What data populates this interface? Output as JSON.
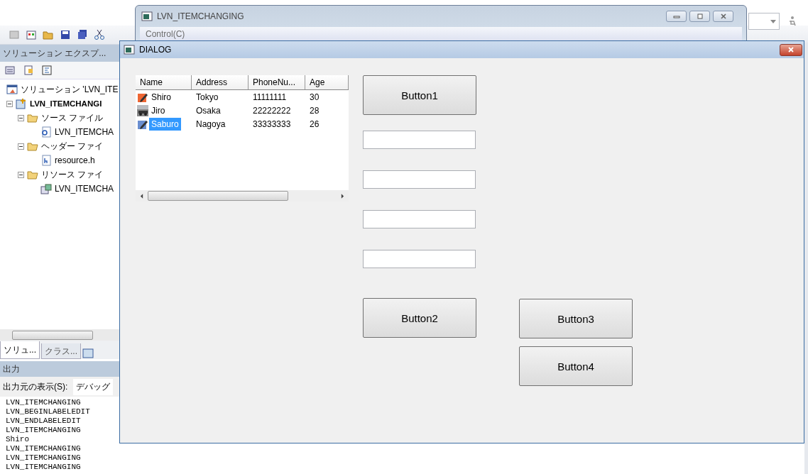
{
  "solution_explorer": {
    "title": "ソリューション エクスプ...",
    "tree": [
      {
        "label": "ソリューション 'LVN_ITE",
        "kind": "solution"
      },
      {
        "label": "LVN_ITEMCHANGI",
        "kind": "project",
        "expanded": true,
        "children": [
          {
            "label": "ソース ファイル",
            "kind": "folder",
            "expanded": true,
            "children": [
              {
                "label": "LVN_ITEMCHA",
                "kind": "cpp"
              }
            ]
          },
          {
            "label": "ヘッダー ファイ",
            "kind": "folder",
            "expanded": true,
            "children": [
              {
                "label": "resource.h",
                "kind": "header"
              }
            ]
          },
          {
            "label": "リソース ファイ",
            "kind": "folder",
            "expanded": true,
            "children": [
              {
                "label": "LVN_ITEMCHA",
                "kind": "resource"
              }
            ]
          }
        ]
      }
    ]
  },
  "bottom_tabs": [
    {
      "label": "ソリュ...",
      "selected": true
    },
    {
      "label": "クラス...",
      "selected": false
    }
  ],
  "output": {
    "title": "出力",
    "source_label": "出力元の表示(S):",
    "source_value": "デバッグ",
    "lines": [
      "LVN_ITEMCHANGING",
      "LVN_BEGINLABELEDIT",
      "LVN_ENDLABELEDIT",
      "LVN_ITEMCHANGING",
      "Shiro",
      "LVN_ITEMCHANGING",
      "LVN_ITEMCHANGING",
      "LVN_ITEMCHANGING"
    ]
  },
  "back_window": {
    "title": "LVN_ITEMCHANGING",
    "menu": [
      "Control(C)"
    ]
  },
  "dialog": {
    "title": "DIALOG",
    "list_view": {
      "columns": [
        "Name",
        "Address",
        "PhoneNu...",
        "Age"
      ],
      "rows": [
        {
          "kind": "pencil",
          "selected": false,
          "cells": [
            "Shiro",
            "Tokyo",
            "11111111",
            "30"
          ]
        },
        {
          "selected": false,
          "cells": [
            "Jiro",
            "Osaka",
            "22222222",
            "28"
          ]
        },
        {
          "kind": "pencil",
          "selected": true,
          "cells": [
            "Saburo",
            "Nagoya",
            "33333333",
            "26"
          ]
        }
      ]
    },
    "buttons": [
      "Button1",
      "Button2",
      "Button3",
      "Button4"
    ],
    "edit_fields": [
      {
        "kind": "edit"
      },
      {
        "kind": "edit"
      },
      {
        "kind": "edit"
      },
      {
        "kind": "edit"
      }
    ]
  }
}
